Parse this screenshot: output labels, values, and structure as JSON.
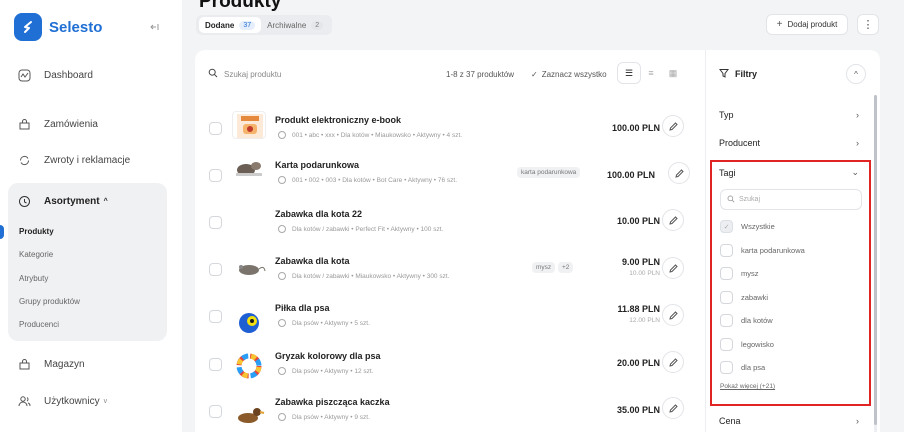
{
  "app": {
    "name": "Selesto",
    "brand_color": "#1f6fd4"
  },
  "sidebar": {
    "items": [
      {
        "label": "Dashboard",
        "icon": "chart-icon"
      },
      {
        "label": "Zamówienia",
        "icon": "shopping-bag-icon"
      },
      {
        "label": "Zwroty i reklamacje",
        "icon": "refresh-icon"
      },
      {
        "label": "Asortyment",
        "icon": "box-icon"
      },
      {
        "label": "Magazyn",
        "icon": "warehouse-icon"
      },
      {
        "label": "Użytkownicy",
        "icon": "users-icon"
      }
    ],
    "submenu": [
      "Produkty",
      "Kategorie",
      "Atrybuty",
      "Grupy produktów",
      "Producenci"
    ]
  },
  "header": {
    "title": "Produkty",
    "tabs": [
      {
        "label": "Dodane",
        "count": "37",
        "selected": true
      },
      {
        "label": "Archiwalne",
        "count": "2",
        "selected": false
      }
    ],
    "add_label": "Dodaj produkt"
  },
  "list": {
    "search_placeholder": "Szukaj produktu",
    "count_text": "1-8 z 37 produktów",
    "select_all": "Zaznacz wszystko",
    "products": [
      {
        "name": "Produkt elektroniczny e-book",
        "meta": "001 • abc • xxx • Dla kotów • Miaukowsko • Aktywny • 4 szt.",
        "price": "100.00 PLN",
        "old_price": "",
        "tags": []
      },
      {
        "name": "Karta podarunkowa",
        "meta": "001 • 002 • 003 • Dla kotów • Bot Care • Aktywny • 76 szt.",
        "price": "100.00 PLN",
        "old_price": "",
        "tags": [
          "karta podarunkowa"
        ]
      },
      {
        "name": "Zabawka dla kota 22",
        "meta": "Dla kotów / zabawki • Perfect Fit • Aktywny • 100 szt.",
        "price": "10.00 PLN",
        "old_price": "",
        "tags": []
      },
      {
        "name": "Zabawka dla kota",
        "meta": "Dla kotów / zabawki • Miaukowsko • Aktywny • 300 szt.",
        "price": "9.00 PLN",
        "old_price": "10.00 PLN",
        "tags": [
          "mysz",
          "+2"
        ]
      },
      {
        "name": "Piłka dla psa",
        "meta": "Dla psów • Aktywny • 5 szt.",
        "price": "11.88 PLN",
        "old_price": "12.00 PLN",
        "tags": []
      },
      {
        "name": "Gryzak kolorowy dla psa",
        "meta": "Dla psów • Aktywny • 12 szt.",
        "price": "20.00 PLN",
        "old_price": "",
        "tags": []
      },
      {
        "name": "Zabawka piszcząca kaczka",
        "meta": "Dla psów • Aktywny • 9 szt.",
        "price": "35.00 PLN",
        "old_price": "",
        "tags": []
      }
    ]
  },
  "filters": {
    "title": "Filtry",
    "sections": [
      "Typ",
      "Producent",
      "Tagi",
      "Cena"
    ],
    "tags_search_placeholder": "Szukaj",
    "tag_options": [
      "Wszystkie",
      "karta podarunkowa",
      "mysz",
      "zabawki",
      "dla kotów",
      "legowisko",
      "dla psa"
    ],
    "show_more": "Pokaż więcej (+21)"
  }
}
